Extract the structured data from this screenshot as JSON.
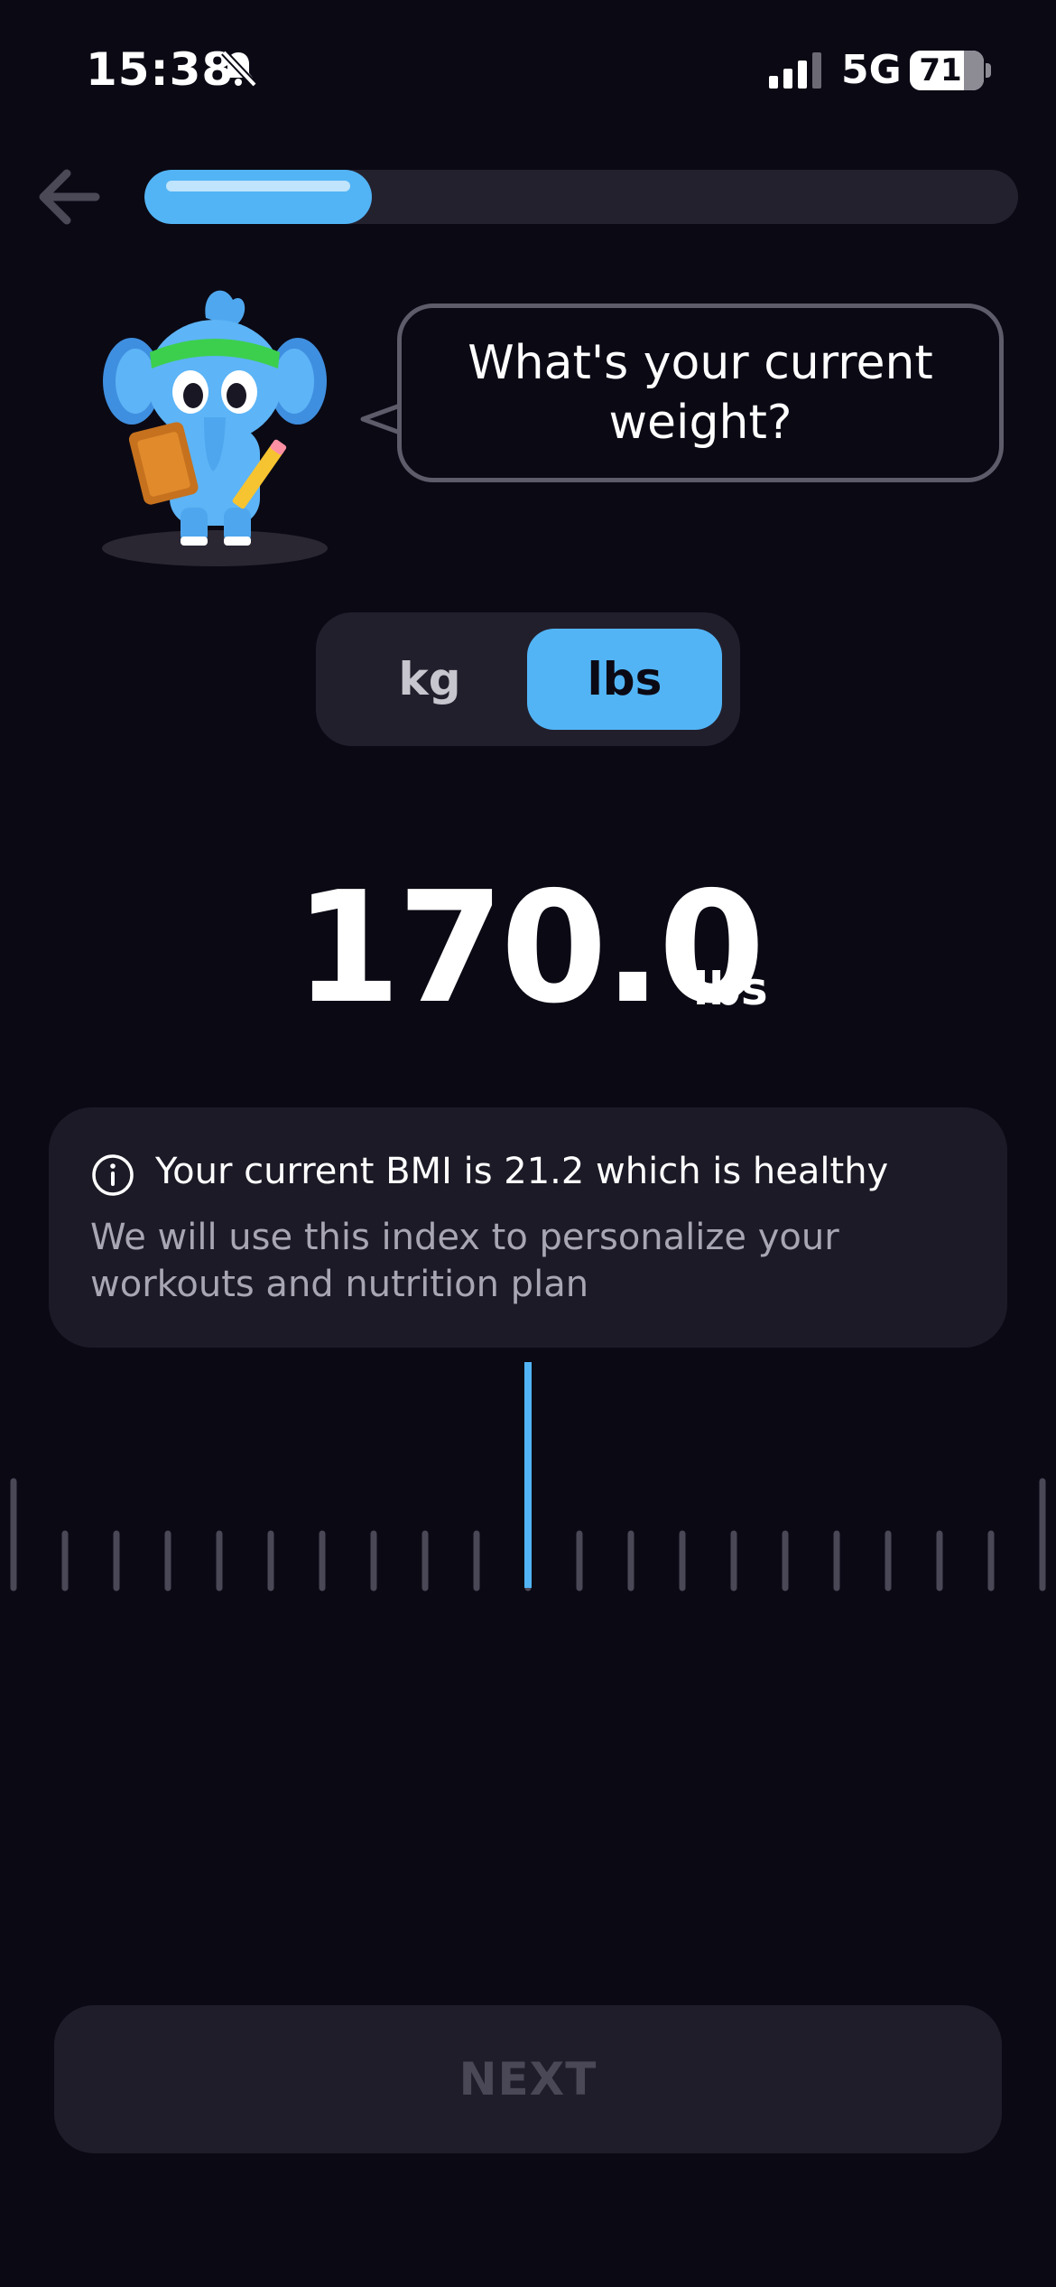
{
  "status_bar": {
    "time": "15:38",
    "network": "5G",
    "battery": "71"
  },
  "progress": {
    "fraction": 0.26
  },
  "question": {
    "text": "What's your current weight?"
  },
  "unit_toggle": {
    "kg_label": "kg",
    "lbs_label": "lbs",
    "selected": "lbs"
  },
  "weight": {
    "value": "170.0",
    "unit": "lbs"
  },
  "bmi": {
    "title": "Your current BMI is 21.2 which is healthy",
    "description": "We will use this index to personalize your workouts and nutrition plan"
  },
  "next_button": {
    "label": "NEXT"
  },
  "colors": {
    "accent": "#52b4f5",
    "background": "#0b0914",
    "card": "#1c1a26"
  }
}
